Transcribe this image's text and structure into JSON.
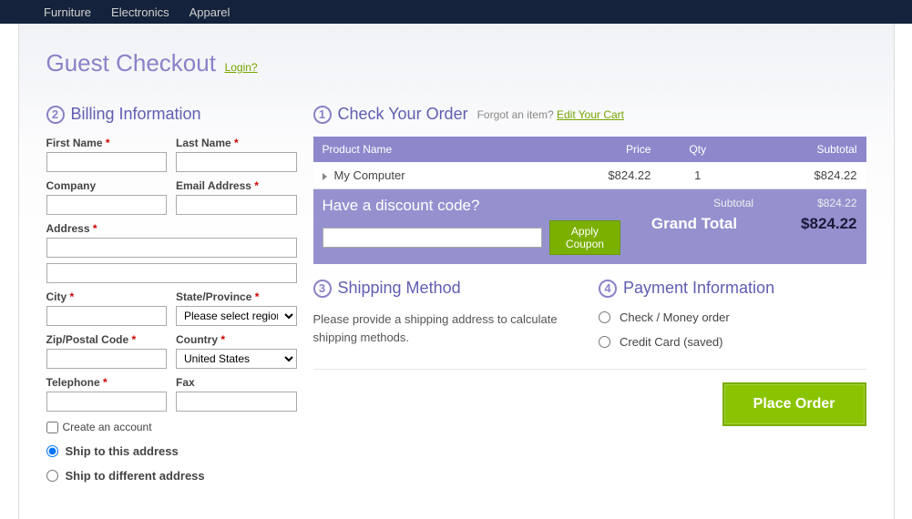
{
  "nav": {
    "items": [
      "Furniture",
      "Electronics",
      "Apparel"
    ]
  },
  "title": "Guest Checkout",
  "login_link": "Login?",
  "billing": {
    "step": "2",
    "title": "Billing Information",
    "first_name": "First Name",
    "last_name": "Last Name",
    "company": "Company",
    "email": "Email Address",
    "address": "Address",
    "city": "City",
    "state": "State/Province",
    "state_placeholder": "Please select region, state or province",
    "zip": "Zip/Postal Code",
    "country": "Country",
    "country_value": "United States",
    "telephone": "Telephone",
    "fax": "Fax",
    "create_account": "Create an account",
    "ship_here": "Ship to this address",
    "ship_diff": "Ship to different address"
  },
  "order": {
    "step": "1",
    "title": "Check Your Order",
    "forgot": "Forgot an item?",
    "edit_cart": "Edit Your Cart",
    "cols": {
      "product": "Product Name",
      "price": "Price",
      "qty": "Qty",
      "subtotal": "Subtotal"
    },
    "rows": [
      {
        "name": "My Computer",
        "price": "$824.22",
        "qty": "1",
        "subtotal": "$824.22"
      }
    ],
    "discount_q": "Have a discount code?",
    "apply": "Apply Coupon",
    "subtotal_label": "Subtotal",
    "subtotal_value": "$824.22",
    "grand_label": "Grand Total",
    "grand_value": "$824.22"
  },
  "shipping": {
    "step": "3",
    "title": "Shipping Method",
    "msg": "Please provide a shipping address to calculate shipping methods."
  },
  "payment": {
    "step": "4",
    "title": "Payment Information",
    "check": "Check / Money order",
    "cc": "Credit Card (saved)"
  },
  "place_order": "Place Order"
}
